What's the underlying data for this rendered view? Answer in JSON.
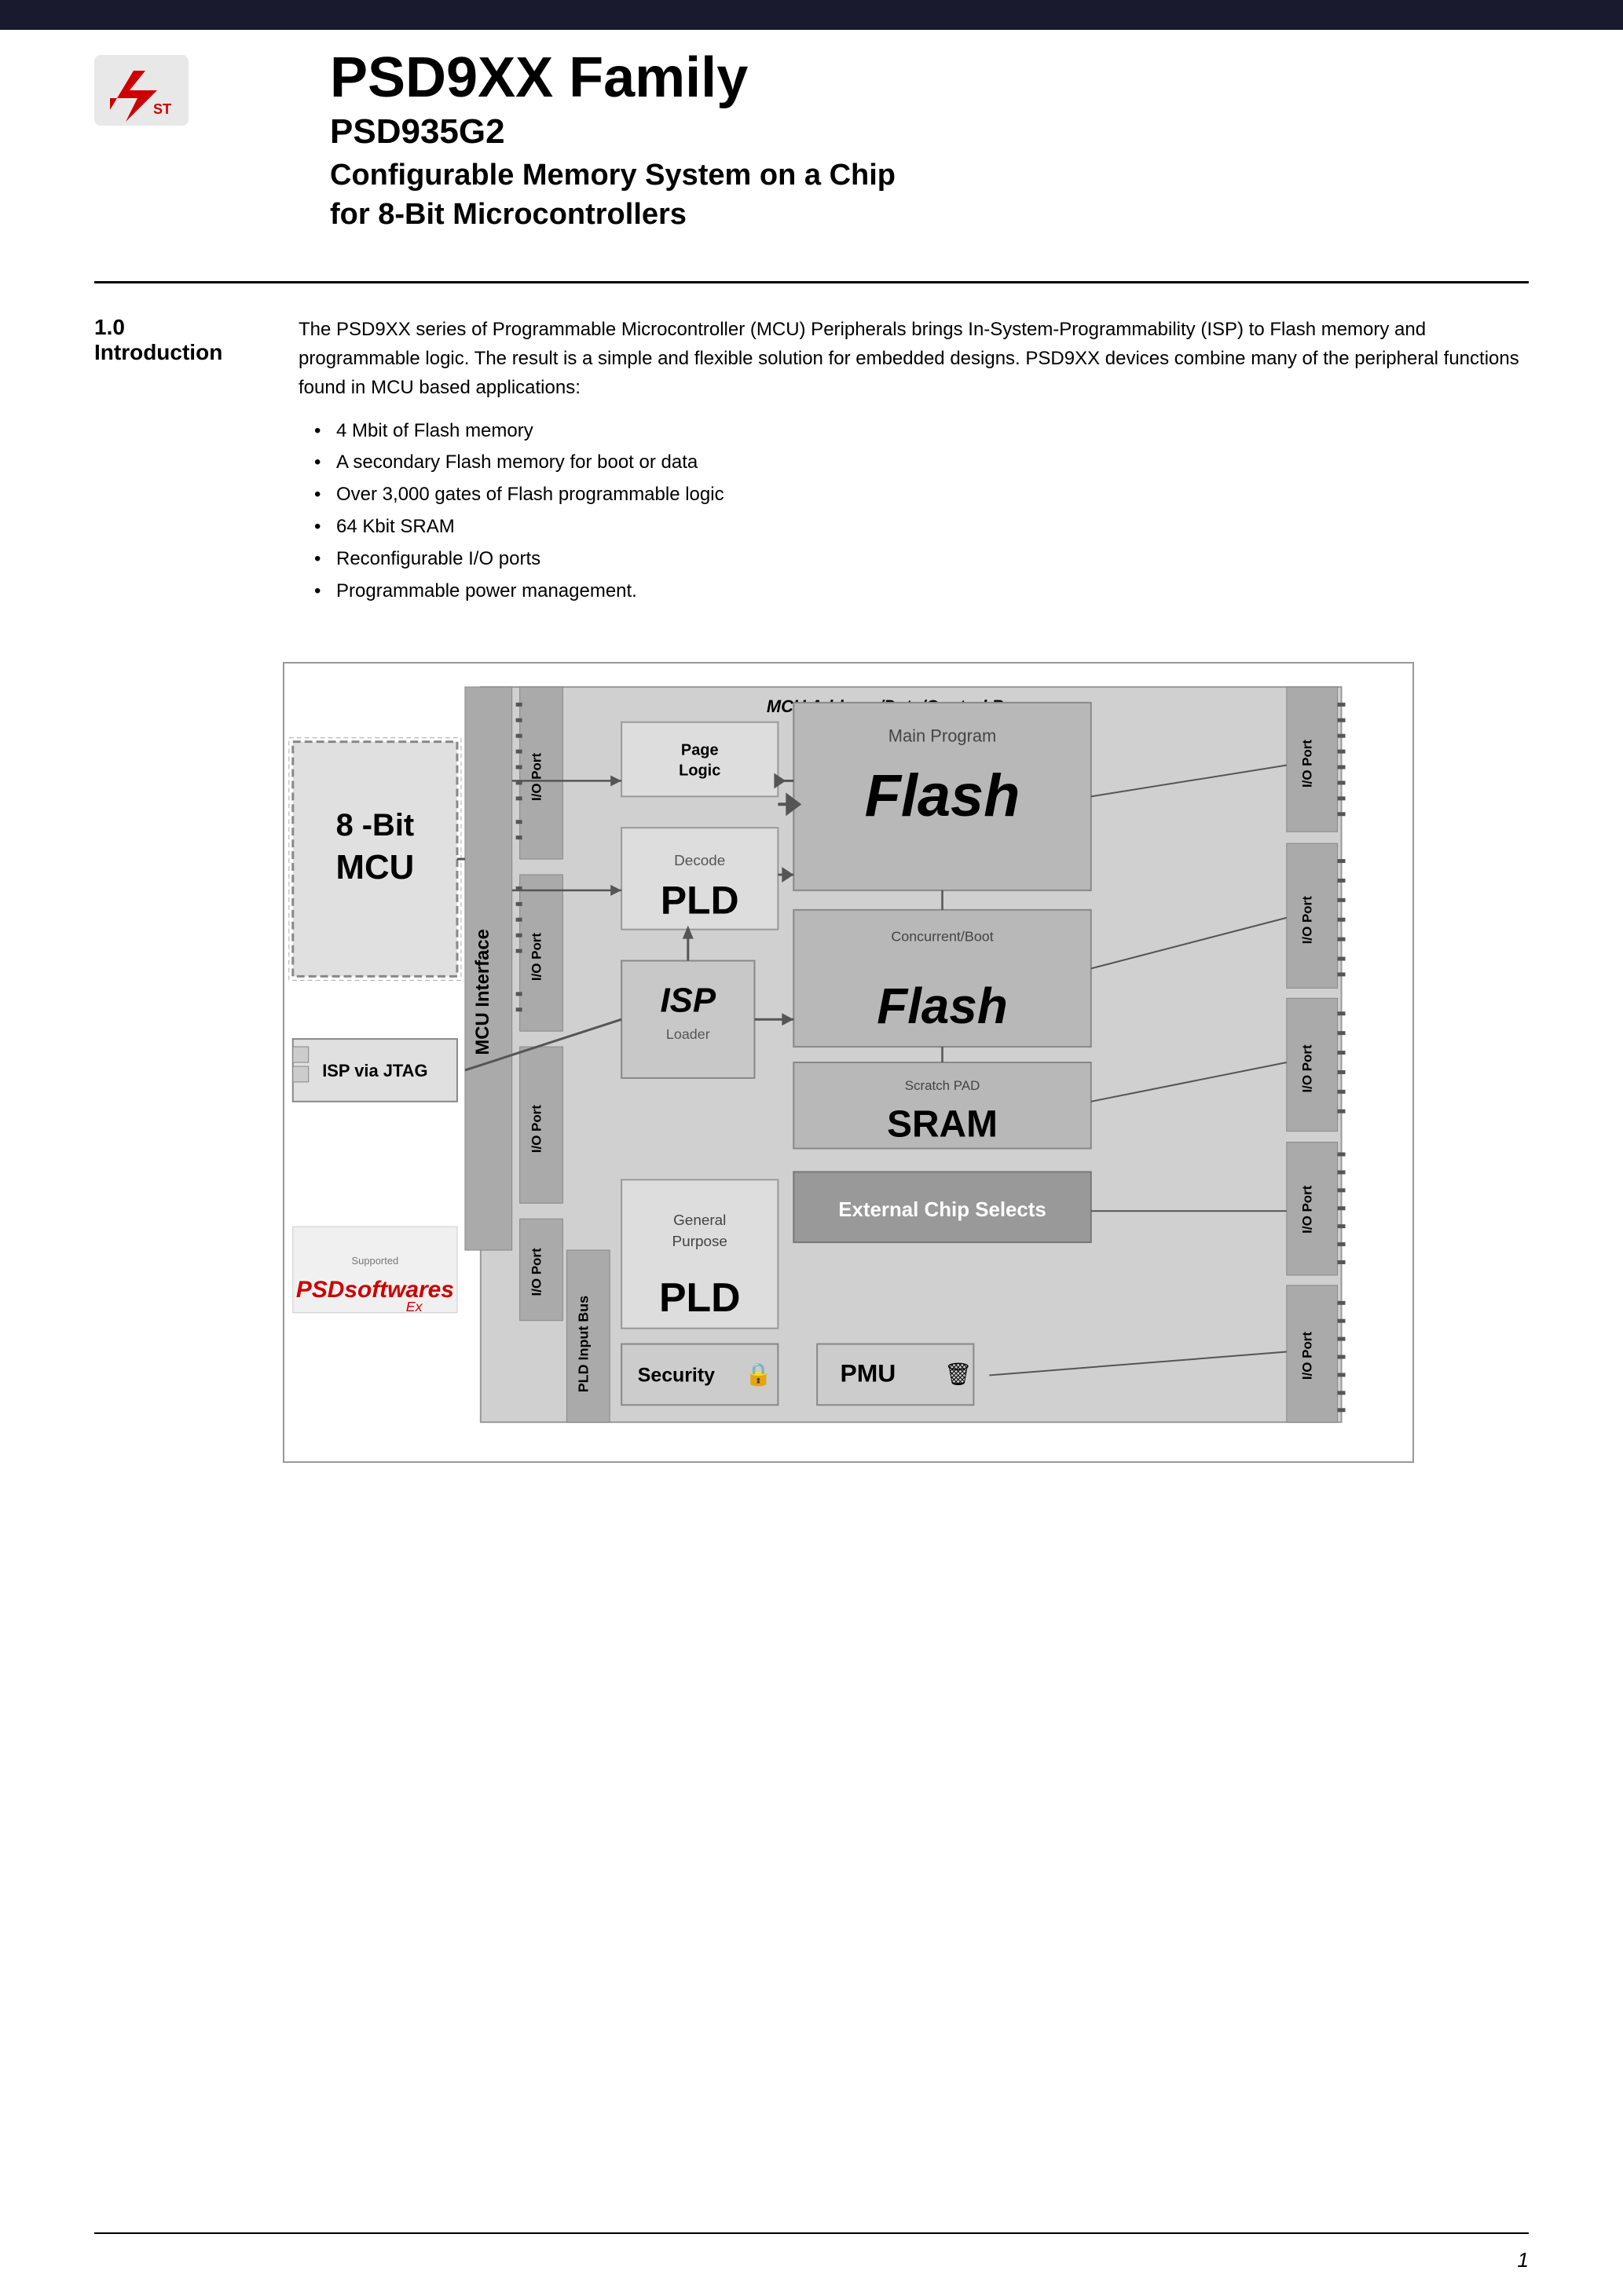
{
  "header": {
    "bar_color": "#1a1a2e",
    "logo_alt": "ST Logo"
  },
  "title": {
    "main": "PSD9XX Family",
    "sub": "PSD935G2",
    "description_line1": "Configurable Memory System on a Chip",
    "description_line2": "for 8-Bit Microcontrollers"
  },
  "section": {
    "number": "1.0",
    "name": "Introduction",
    "paragraph": "The PSD9XX series of Programmable Microcontroller (MCU) Peripherals brings In-System-Programmability (ISP) to Flash memory and programmable logic. The result is a simple and flexible solution for embedded designs. PSD9XX devices combine many of the peripheral functions found in MCU based applications:",
    "bullets": [
      "4 Mbit of Flash memory",
      "A secondary Flash memory for boot or data",
      "Over 3,000 gates of Flash programmable logic",
      "64 Kbit SRAM",
      "Reconfigurable I/O ports",
      "Programmable power management."
    ]
  },
  "diagram": {
    "bus_label": "MCU Address/Data/Control Bus",
    "mcu_label_line1": "8 -Bit",
    "mcu_label_line2": "MCU",
    "mcu_interface_label": "MCU Interface",
    "page_logic_label": "Page\nLogic",
    "main_program_label": "Main Program",
    "flash_big": "Flash",
    "decode_label": "Decode",
    "pld_big": "PLD",
    "concurrent_label": "Concurrent/Boot",
    "concurrent_flash": "Flash",
    "scratch_pad_label": "Scratch PAD",
    "sram_label": "SRAM",
    "isp_via_jtag_label": "ISP via JTAG",
    "isp_label": "ISP",
    "loader_label": "Loader",
    "general_purpose_label": "General\nPurpose",
    "gp_pld_label": "PLD",
    "ext_chip_selects": "External Chip Selects",
    "pld_input_bus": "PLD Input Bus",
    "security_label": "Security",
    "pmu_label": "PMU",
    "io_port_label": "I/O Port",
    "supported_label": "Supported"
  },
  "footer": {
    "page_number": "1"
  }
}
